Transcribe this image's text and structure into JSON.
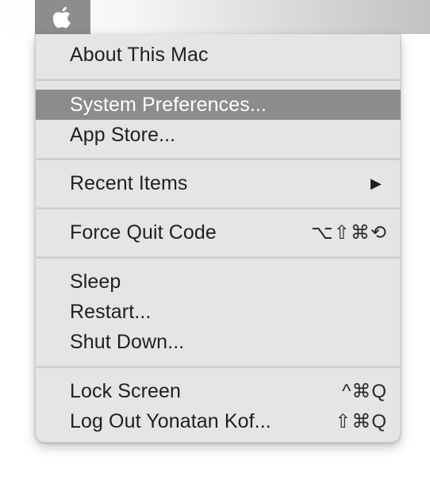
{
  "menubar": {
    "apple_icon": "apple-logo-icon"
  },
  "menu": {
    "about": "About This Mac",
    "system_preferences": "System Preferences...",
    "app_store": "App Store...",
    "recent_items": "Recent Items",
    "recent_items_arrow": "▶",
    "force_quit": "Force Quit Code",
    "force_quit_shortcut": "⌥⇧⌘⟲",
    "sleep": "Sleep",
    "restart": "Restart...",
    "shut_down": "Shut Down...",
    "lock_screen": "Lock Screen",
    "lock_screen_shortcut": "^⌘Q",
    "log_out": "Log Out Yonatan Kof...",
    "log_out_shortcut": "⇧⌘Q"
  },
  "colors": {
    "menu_background": "#e5e5e5",
    "highlight": "#8c8c8c",
    "apple_button": "#8d8d8d",
    "text": "#1f1f1f"
  }
}
